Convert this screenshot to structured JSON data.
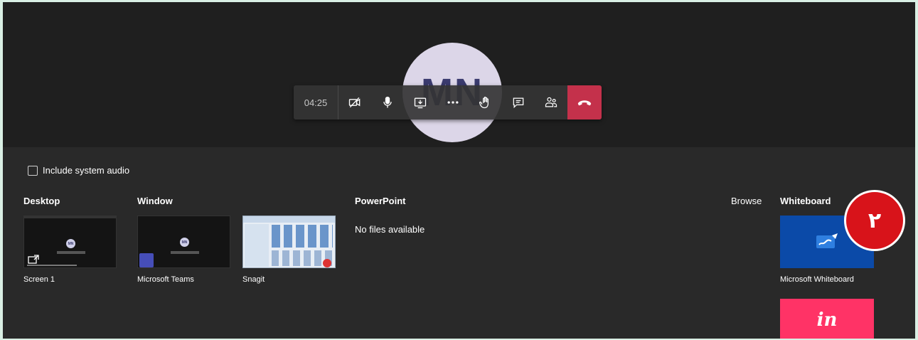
{
  "call": {
    "avatar_initials": "MN",
    "timer": "04:25",
    "toolbar": {
      "buttons": [
        {
          "name": "camera-off-icon"
        },
        {
          "name": "microphone-icon"
        },
        {
          "name": "share-screen-icon"
        },
        {
          "name": "more-options-icon"
        },
        {
          "name": "raise-hand-icon"
        },
        {
          "name": "chat-icon"
        },
        {
          "name": "participants-icon"
        }
      ],
      "hangup": "phone-hangup-icon"
    }
  },
  "share_panel": {
    "include_audio_label": "Include system audio",
    "include_audio_checked": false,
    "sections": {
      "desktop": "Desktop",
      "window": "Window",
      "powerpoint": "PowerPoint",
      "browse": "Browse",
      "whiteboard": "Whiteboard"
    },
    "desktop_items": [
      {
        "label": "Screen 1"
      }
    ],
    "window_items": [
      {
        "label": "Microsoft Teams"
      },
      {
        "label": "Snagit"
      }
    ],
    "powerpoint_empty": "No files available",
    "whiteboard_items": [
      {
        "label": "Microsoft Whiteboard"
      }
    ],
    "invision_logo": "in"
  },
  "annotation_badge": "٢",
  "colors": {
    "hangup": "#c4314b",
    "whiteboard_tile": "#0b4aa8",
    "invision_tile": "#ff3366",
    "badge": "#d8131a"
  }
}
